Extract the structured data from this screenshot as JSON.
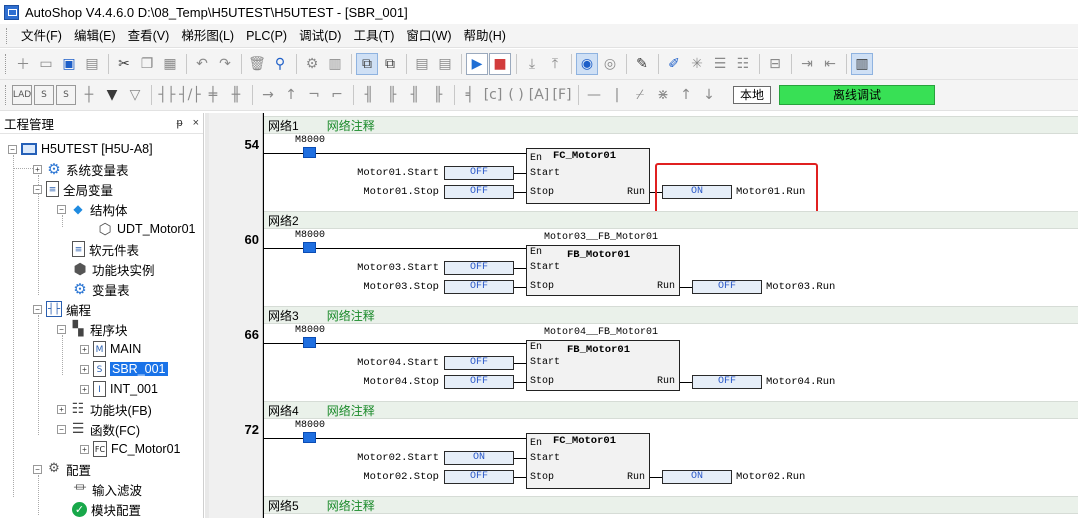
{
  "window": {
    "title": "AutoShop V4.4.6.0  D:\\08_Temp\\H5UTEST\\H5UTEST - [SBR_001]"
  },
  "menu": [
    "文件(F)",
    "编辑(E)",
    "查看(V)",
    "梯形图(L)",
    "PLC(P)",
    "调试(D)",
    "工具(T)",
    "窗口(W)",
    "帮助(H)"
  ],
  "toolbar2": {
    "icons": [
      "LAD",
      "S",
      "S"
    ],
    "local_label": "本地",
    "offline_label": "离线调试",
    "offline_color": "#38e055"
  },
  "panel": {
    "title": "工程管理",
    "pin": "ᵽ",
    "close": "×"
  },
  "tree": [
    {
      "label": "H5UTEST [H5U-A8]",
      "icon": "plc-icon"
    },
    {
      "label": "系统变量表",
      "icon": "system-vars-icon"
    },
    {
      "label": "全局变量",
      "icon": "global-vars-icon"
    },
    {
      "label": "结构体",
      "icon": "struct-icon"
    },
    {
      "label": "UDT_Motor01",
      "icon": "udt-icon"
    },
    {
      "label": "软元件表",
      "icon": "device-table-icon"
    },
    {
      "label": "功能块实例",
      "icon": "fb-instance-icon"
    },
    {
      "label": "变量表",
      "icon": "var-table-icon"
    },
    {
      "label": "编程",
      "icon": "programming-icon"
    },
    {
      "label": "程序块",
      "icon": "program-block-icon"
    },
    {
      "label": "MAIN",
      "icon": "program-icon"
    },
    {
      "label": "SBR_001",
      "icon": "program-icon"
    },
    {
      "label": "INT_001",
      "icon": "program-icon"
    },
    {
      "label": "功能块(FB)",
      "icon": "fb-icon"
    },
    {
      "label": "函数(FC)",
      "icon": "fc-folder-icon"
    },
    {
      "label": "FC_Motor01",
      "icon": "fc-icon"
    },
    {
      "label": "配置",
      "icon": "config-icon"
    },
    {
      "label": "输入滤波",
      "icon": "input-filter-icon"
    },
    {
      "label": "模块配置",
      "icon": "module-config-icon"
    }
  ],
  "networks": [
    {
      "header": "网络1",
      "comment": "网络注释",
      "step": "54",
      "contact": "M8000",
      "instance": "",
      "block": "FC_Motor01",
      "pins": {
        "en": "En",
        "start": "Start",
        "stop": "Stop",
        "run": "Run"
      },
      "start_var": "Motor01.Start",
      "start_val": "OFF",
      "stop_var": "Motor01.Stop",
      "stop_val": "OFF",
      "run_val": "ON",
      "run_var": "Motor01.Run"
    },
    {
      "header": "网络2",
      "comment": "",
      "step": "60",
      "contact": "M8000",
      "instance": "Motor03__FB_Motor01",
      "block": "FB_Motor01",
      "pins": {
        "en": "En",
        "start": "Start",
        "stop": "Stop",
        "run": "Run"
      },
      "start_var": "Motor03.Start",
      "start_val": "OFF",
      "stop_var": "Motor03.Stop",
      "stop_val": "OFF",
      "run_val": "OFF",
      "run_var": "Motor03.Run"
    },
    {
      "header": "网络3",
      "comment": "网络注释",
      "step": "66",
      "contact": "M8000",
      "instance": "Motor04__FB_Motor01",
      "block": "FB_Motor01",
      "pins": {
        "en": "En",
        "start": "Start",
        "stop": "Stop",
        "run": "Run"
      },
      "start_var": "Motor04.Start",
      "start_val": "OFF",
      "stop_var": "Motor04.Stop",
      "stop_val": "OFF",
      "run_val": "OFF",
      "run_var": "Motor04.Run"
    },
    {
      "header": "网络4",
      "comment": "网络注释",
      "step": "72",
      "contact": "M8000",
      "instance": "",
      "block": "FC_Motor01",
      "pins": {
        "en": "En",
        "start": "Start",
        "stop": "Stop",
        "run": "Run"
      },
      "start_var": "Motor02.Start",
      "start_val": "ON",
      "stop_var": "Motor02.Stop",
      "stop_val": "OFF",
      "run_val": "ON",
      "run_var": "Motor02.Run"
    },
    {
      "header": "网络5",
      "comment": "网络注释"
    }
  ],
  "colors": {
    "highlight": "#e02020",
    "contact": "#1f6fe0",
    "value_text": "#2a58c8",
    "comment": "#1a8a2a"
  }
}
